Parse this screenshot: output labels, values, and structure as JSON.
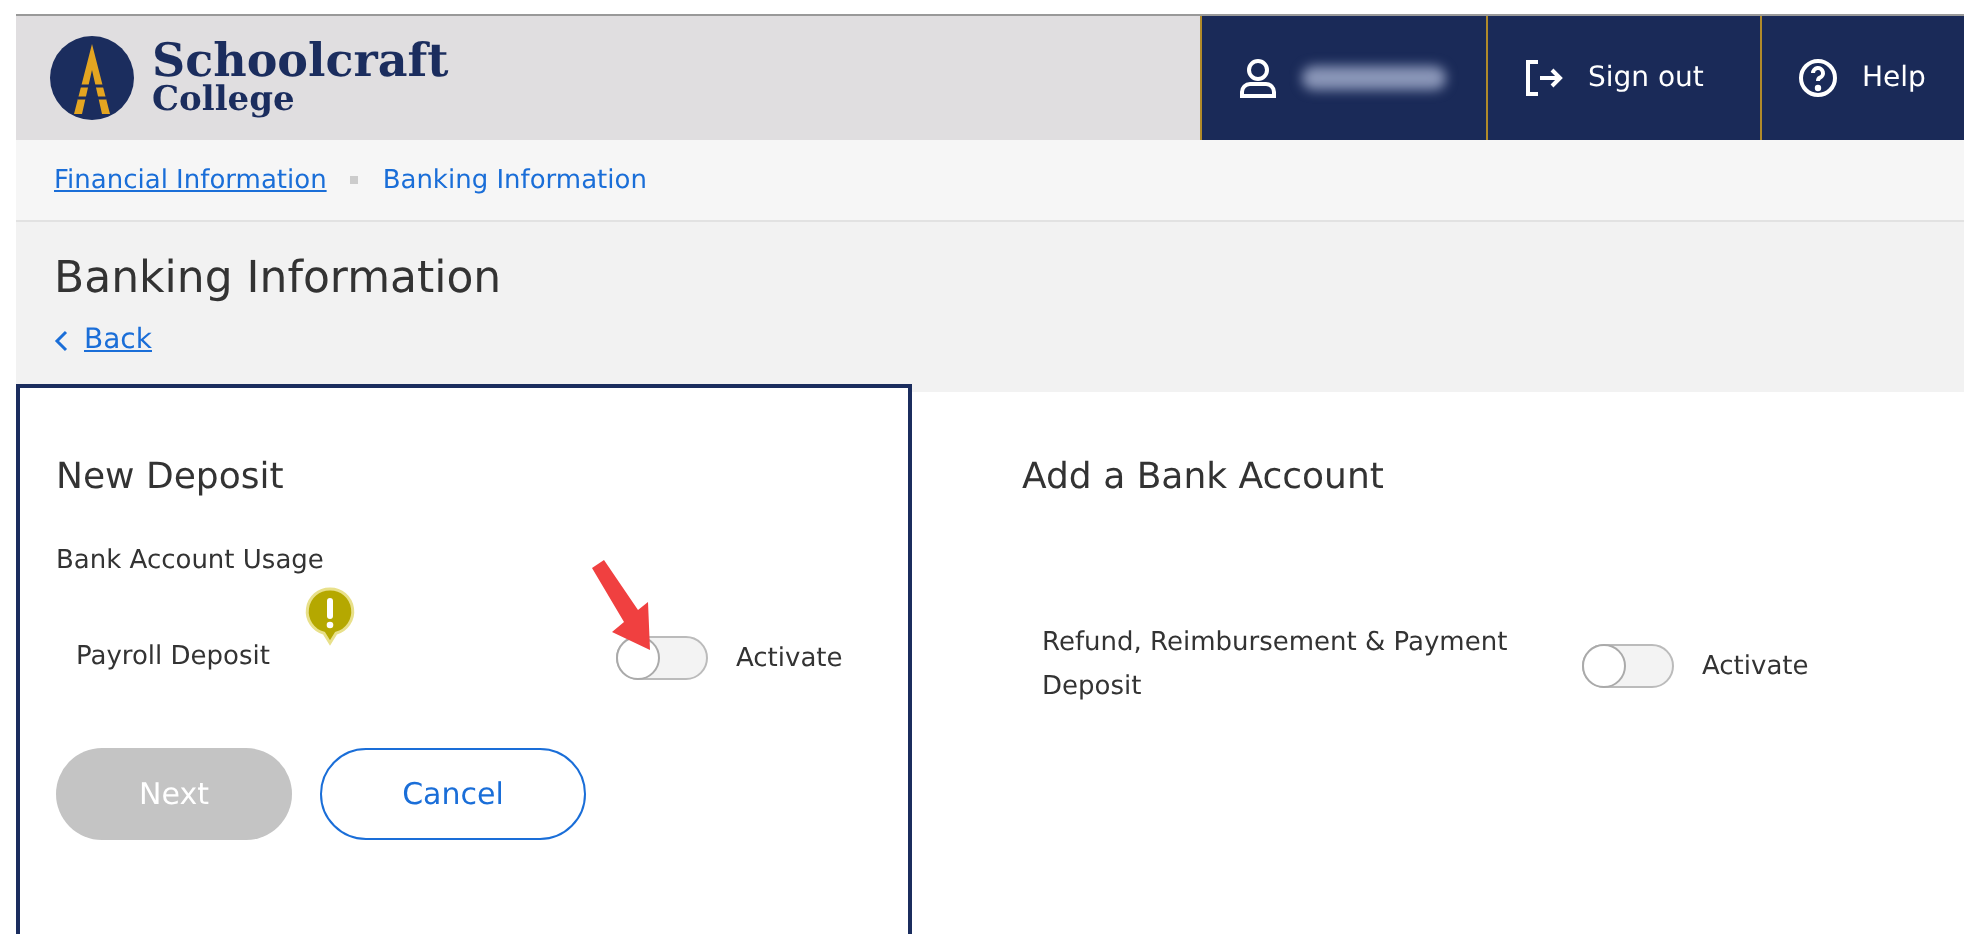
{
  "header": {
    "logo": {
      "line1": "Schoolcraft",
      "line2": "College"
    },
    "nav": [
      {
        "kind": "user"
      },
      {
        "kind": "signout",
        "label": "Sign out"
      },
      {
        "kind": "help",
        "label": "Help"
      }
    ]
  },
  "breadcrumbs": [
    {
      "label": "Financial Information",
      "link": true
    },
    {
      "label": "Banking Information",
      "link": false
    }
  ],
  "page": {
    "title": "Banking Information",
    "back": "Back"
  },
  "new_deposit": {
    "title": "New Deposit",
    "subtitle": "Bank Account Usage",
    "option": {
      "label": "Payroll Deposit",
      "on": false,
      "toggle_label": "Activate"
    },
    "buttons": [
      {
        "label": "Next",
        "disabled": true
      },
      {
        "label": "Cancel",
        "disabled": false
      }
    ]
  },
  "add_account": {
    "title": "Add a Bank Account",
    "option": {
      "label": "Refund, Reimbursement & Payment Deposit",
      "on": false,
      "toggle_label": "Activate"
    }
  }
}
